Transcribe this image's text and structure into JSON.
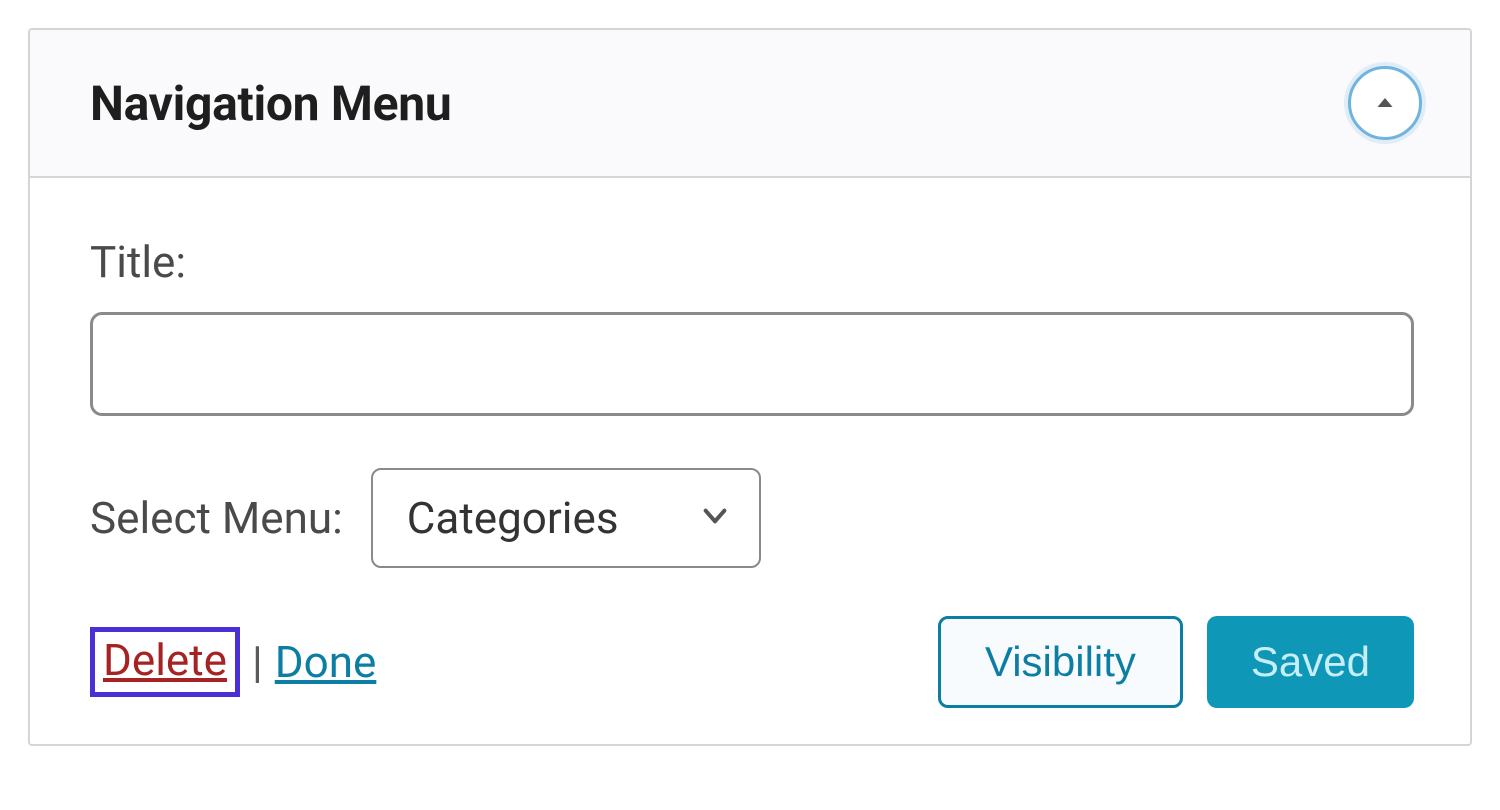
{
  "widget": {
    "title": "Navigation Menu",
    "fields": {
      "title_label": "Title:",
      "title_value": "",
      "select_label": "Select Menu:",
      "select_value": "Categories"
    },
    "actions": {
      "delete": "Delete",
      "separator": "|",
      "done": "Done",
      "visibility": "Visibility",
      "saved": "Saved"
    }
  }
}
